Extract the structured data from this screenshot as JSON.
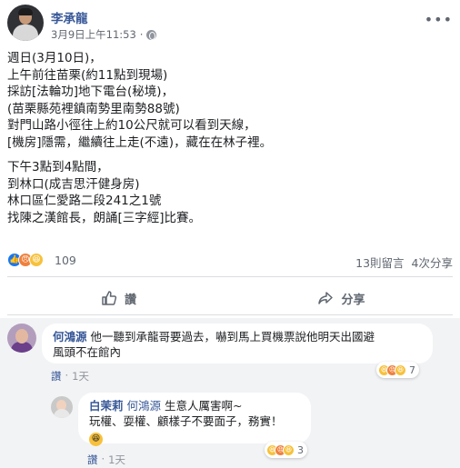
{
  "post": {
    "author": "李承龍",
    "timestamp": "3月9日上午11:53",
    "separator": "·",
    "privacy_icon": "globe-icon",
    "more_icon": "more-horizontal-icon",
    "paragraphs": [
      [
        "週日(3月10日)，",
        "上午前往苗栗(約11點到現場)",
        "採訪[法輪功]地下電台(秘境)，",
        "(苗栗縣苑裡鎮南勢里南勢88號)",
        "對門山路小徑往上約10公尺就可以看到天線，",
        "[機房]隱需，繼續往上走(不遠)，藏在在林子裡。"
      ],
      [
        "下午3點到4點間，",
        "到林口(成吉思汗健身房)",
        "林口區仁愛路二段241之1號",
        "找陳之漢館長，朗誦[三字經]比賽。"
      ]
    ]
  },
  "stats": {
    "reaction_count": "109",
    "comments": "13則留言",
    "shares": "4次分享",
    "reaction_icons": [
      "like-icon",
      "angry-icon",
      "haha-icon"
    ]
  },
  "actions": {
    "like_label": "讚",
    "share_label": "分享"
  },
  "colors": {
    "link_blue": "#385898",
    "meta_gray": "#616770",
    "comment_bg": "#f2f3f5",
    "like_blue": "#1877f2"
  },
  "comments": [
    {
      "author": "何鴻源",
      "text_line1": "他一聽到承龍哥要過去，嚇到馬上買機票說他明天出國避",
      "text_line2": "風頭不在館內",
      "reaction_count": "7",
      "like_label": "讚",
      "time": "1天",
      "dot": "·"
    },
    {
      "author": "白茉莉",
      "mention": "何鴻源",
      "text_line1": "生意人厲害啊~",
      "text_line2": "玩權、耍權、顧樣子不要面子，務實！",
      "emoji_icon": "laughing-face-icon",
      "reaction_count": "3",
      "like_label": "讚",
      "time": "1天",
      "dot": "·"
    }
  ]
}
